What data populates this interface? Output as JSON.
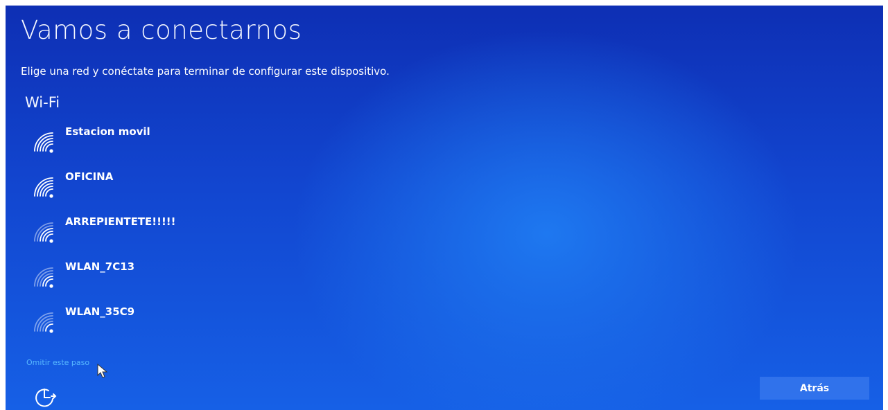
{
  "header": {
    "title": "Vamos a conectarnos",
    "subtitle": "Elige una red y conéctate para terminar de configurar este dispositivo."
  },
  "wifi": {
    "section_label": "Wi-Fi",
    "networks": [
      {
        "name": "Estacion movil",
        "icon": "wifi-signal-icon"
      },
      {
        "name": "OFICINA",
        "icon": "wifi-signal-icon"
      },
      {
        "name": "ARREPIENTETE!!!!!",
        "icon": "wifi-signal-icon"
      },
      {
        "name": "WLAN_7C13",
        "icon": "wifi-signal-icon"
      },
      {
        "name": "WLAN_35C9",
        "icon": "wifi-signal-icon"
      }
    ]
  },
  "footer": {
    "skip_label": "Omitir este paso",
    "back_label": "Atrás",
    "accessibility_icon": "accessibility-icon"
  },
  "colors": {
    "background": "#1246d0",
    "link": "#57b8ff",
    "text": "#ffffff"
  }
}
